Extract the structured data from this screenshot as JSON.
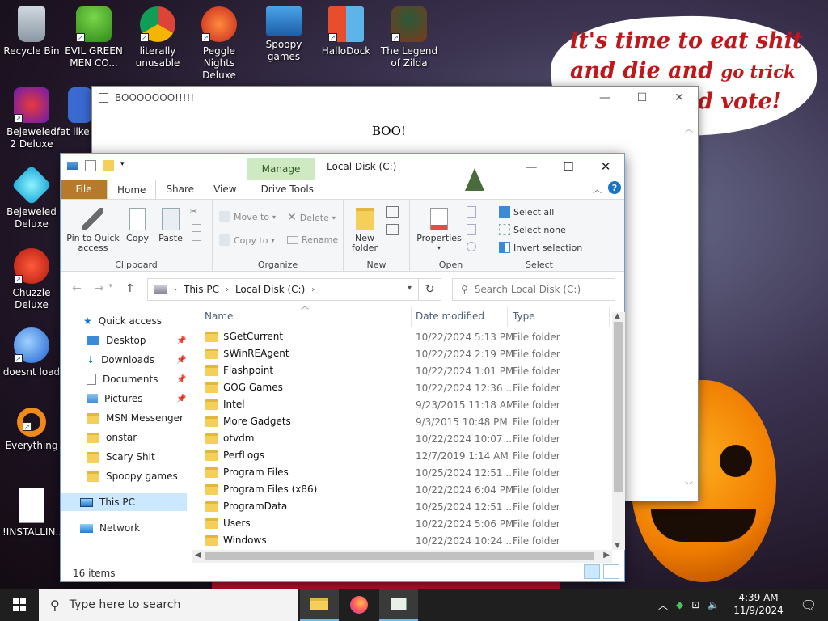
{
  "desktop": {
    "icons": [
      {
        "label": "Recycle Bin",
        "icon": "recycle-bin-icon"
      },
      {
        "label": "EVIL GREEN MEN CO...",
        "icon": "msn-buddy-icon"
      },
      {
        "label": "literally unusable",
        "icon": "chrome-icon"
      },
      {
        "label": "Peggle Nights Deluxe",
        "icon": "peggle-icon"
      },
      {
        "label": "Spoopy games",
        "icon": "network-computers-icon"
      },
      {
        "label": "HalloDock",
        "icon": "dock-app-icon"
      },
      {
        "label": "The Legend of Zilda",
        "icon": "zilda-icon"
      },
      {
        "label": "Bejeweled 2 Deluxe",
        "icon": "bejeweled2-icon"
      },
      {
        "label": "fat like",
        "icon": "fat-like-icon"
      },
      {
        "label": "Bejeweled Deluxe",
        "icon": "gem-icon"
      },
      {
        "label": "Chuzzle Deluxe",
        "icon": "chuzzle-icon"
      },
      {
        "label": "doesnt load",
        "icon": "thunderbird-icon"
      },
      {
        "label": "Everything",
        "icon": "everything-search-icon"
      },
      {
        "label": "!INSTALLIN...",
        "icon": "text-document-icon"
      }
    ],
    "wallpaper_caption": {
      "line1": "it's time to eat shit",
      "line2a": "and die and ",
      "line2b": "go trick",
      "line3a": "d vote!"
    }
  },
  "boo_window": {
    "title": "BOOOOOOO!!!!!",
    "text": "BOO!"
  },
  "explorer": {
    "contextual_tab": "Manage",
    "caption": "Local Disk (C:)",
    "tabs": [
      "File",
      "Home",
      "Share",
      "View",
      "Drive Tools"
    ],
    "ribbon": {
      "clipboard": {
        "pin": "Pin to Quick access",
        "copy": "Copy",
        "paste": "Paste",
        "label": "Clipboard"
      },
      "organize": {
        "move_to": "Move to",
        "copy_to": "Copy to",
        "delete": "Delete",
        "rename": "Rename",
        "label": "Organize"
      },
      "new": {
        "new_folder": "New folder",
        "label": "New"
      },
      "open": {
        "properties": "Properties",
        "label": "Open"
      },
      "select": {
        "select_all": "Select all",
        "select_none": "Select none",
        "invert": "Invert selection",
        "label": "Select"
      }
    },
    "address": {
      "crumbs": [
        "This PC",
        "Local Disk (C:)"
      ]
    },
    "search_placeholder": "Search Local Disk (C:)",
    "nav": {
      "quick_access": "Quick access",
      "pinned": [
        "Desktop",
        "Downloads",
        "Documents",
        "Pictures"
      ],
      "folders": [
        "MSN Messenger",
        "onstar",
        "Scary Shit",
        "Spoopy games"
      ],
      "this_pc": "This PC",
      "network": "Network"
    },
    "columns": {
      "name": "Name",
      "date": "Date modified",
      "type": "Type"
    },
    "rows": [
      {
        "name": "$GetCurrent",
        "date": "10/22/2024 5:13 PM",
        "type": "File folder"
      },
      {
        "name": "$WinREAgent",
        "date": "10/22/2024 2:19 PM",
        "type": "File folder"
      },
      {
        "name": "Flashpoint",
        "date": "10/22/2024 1:01 PM",
        "type": "File folder"
      },
      {
        "name": "GOG Games",
        "date": "10/22/2024 12:36 ...",
        "type": "File folder"
      },
      {
        "name": "Intel",
        "date": "9/23/2015 11:18 AM",
        "type": "File folder"
      },
      {
        "name": "More Gadgets",
        "date": "9/3/2015 10:48 PM",
        "type": "File folder"
      },
      {
        "name": "otvdm",
        "date": "10/22/2024 10:07 ...",
        "type": "File folder"
      },
      {
        "name": "PerfLogs",
        "date": "12/7/2019 1:14 AM",
        "type": "File folder"
      },
      {
        "name": "Program Files",
        "date": "10/25/2024 12:51 ...",
        "type": "File folder"
      },
      {
        "name": "Program Files (x86)",
        "date": "10/22/2024 6:04 PM",
        "type": "File folder"
      },
      {
        "name": "ProgramData",
        "date": "10/25/2024 12:51 ...",
        "type": "File folder"
      },
      {
        "name": "Users",
        "date": "10/22/2024 5:06 PM",
        "type": "File folder"
      },
      {
        "name": "Windows",
        "date": "10/22/2024 10:24 ...",
        "type": "File folder"
      }
    ],
    "status": "16 items"
  },
  "taskbar": {
    "search_placeholder": "Type here to search",
    "time": "4:39 AM",
    "date": "11/9/2024"
  },
  "colors": {
    "file_tab": "#b57a2a",
    "manage_tab": "#cfeac3",
    "selection": "#cce8ff",
    "caption_red": "#c0171b"
  }
}
